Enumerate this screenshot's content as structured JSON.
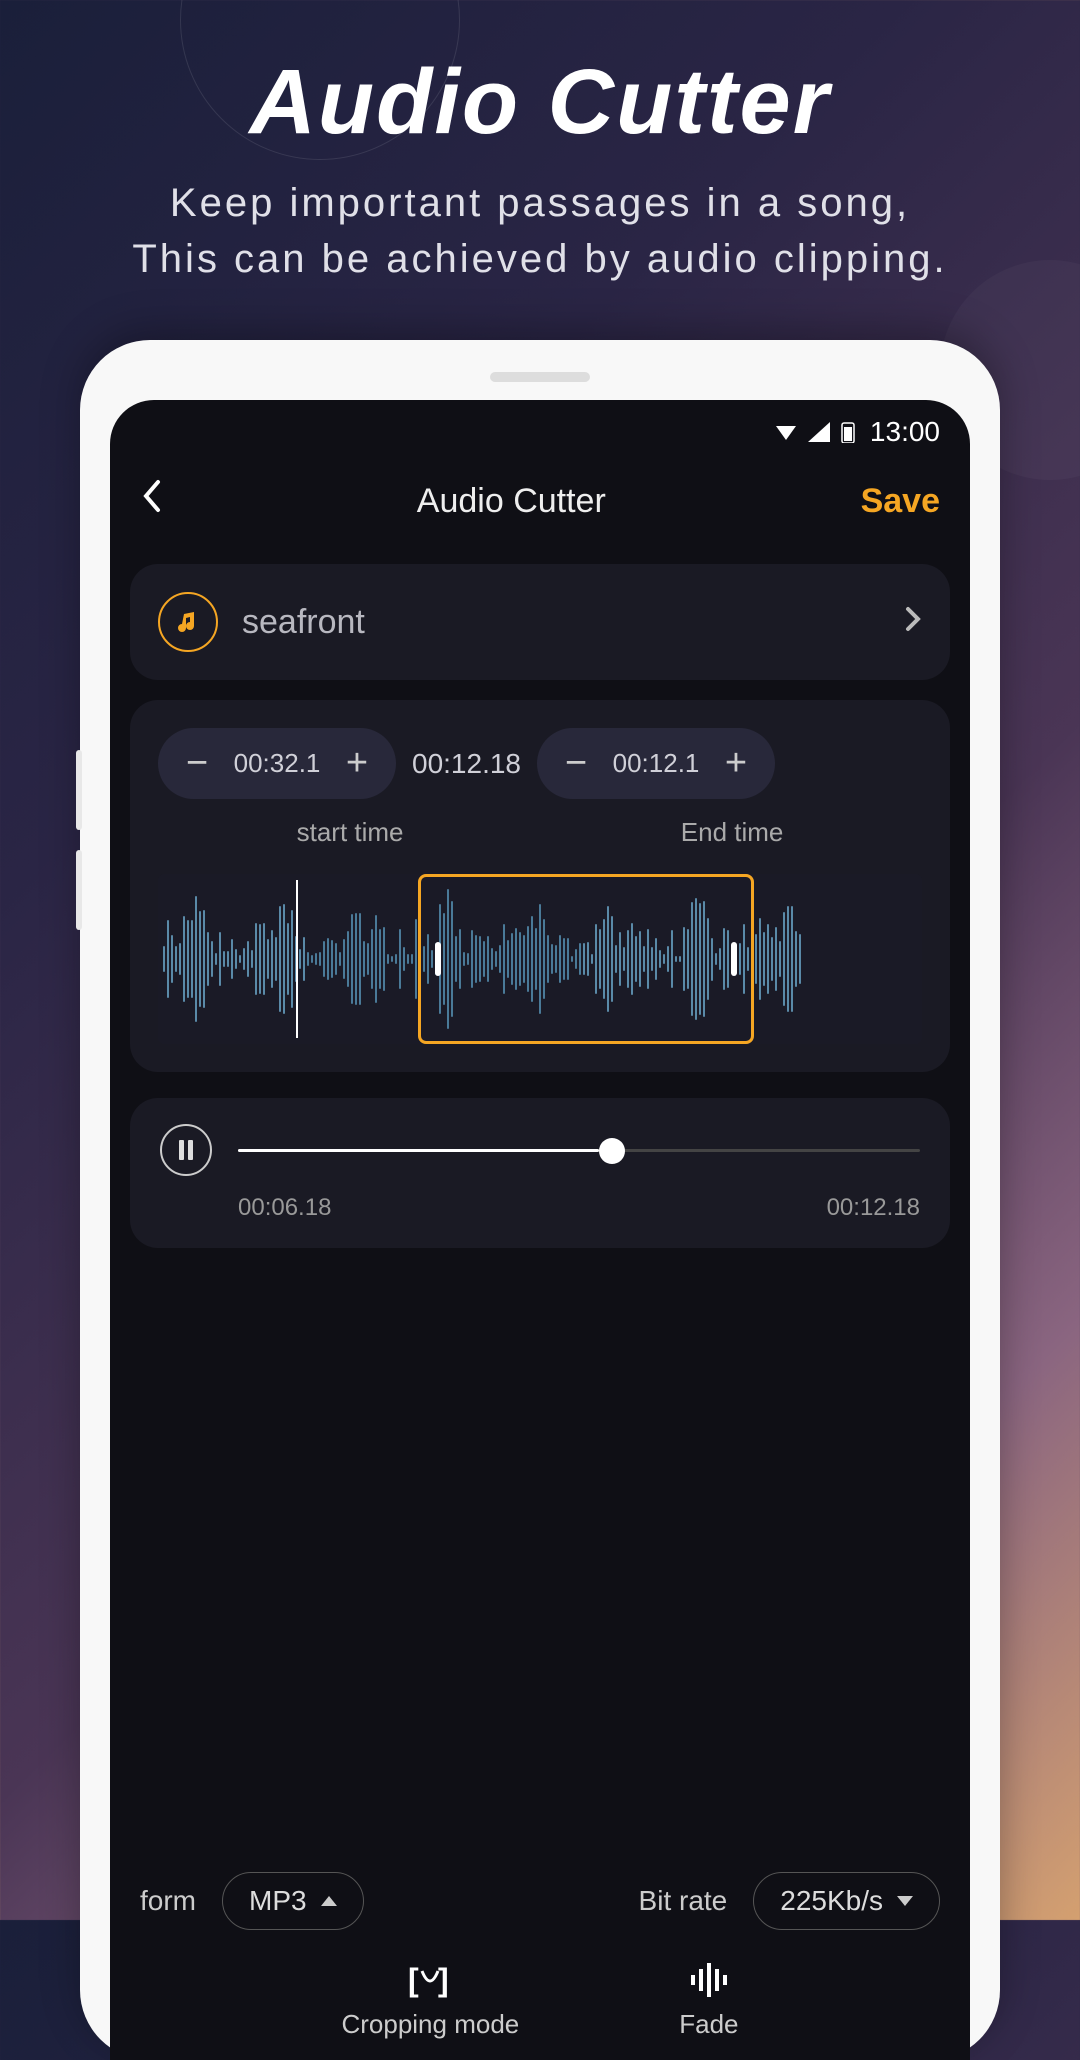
{
  "hero": {
    "title": "Audio Cutter",
    "subtitle_line1": "Keep important passages in a song,",
    "subtitle_line2": "This can be achieved by audio clipping."
  },
  "status": {
    "time": "13:00"
  },
  "header": {
    "title": "Audio Cutter",
    "save": "Save"
  },
  "track": {
    "name": "seafront"
  },
  "times": {
    "start_value": "00:32.1",
    "center": "00:12.18",
    "end_value": "00:12.1",
    "start_label": "start time",
    "end_label": "End time"
  },
  "player": {
    "current": "00:06.18",
    "total": "00:12.18"
  },
  "options": {
    "form_label": "form",
    "form_value": "MP3",
    "bitrate_label": "Bit rate",
    "bitrate_value": "225Kb/s"
  },
  "tabs": {
    "cropping": "Cropping mode",
    "fade": "Fade"
  }
}
